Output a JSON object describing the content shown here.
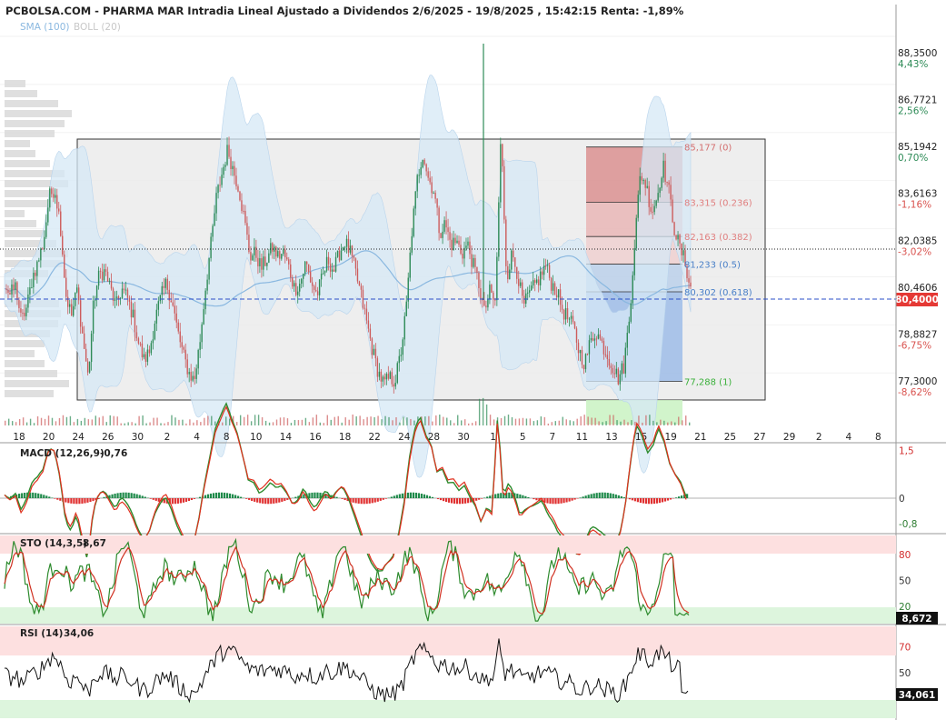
{
  "header": {
    "title": "PCBOLSA.COM - PHARMA MAR Intradia Lineal Ajustado a Dividendos 2/6/2025 - 19/8/2025 , 15:42:15 Renta: -1,89%",
    "legend_sma": "SMA (100)",
    "legend_boll": "BOLL (20)"
  },
  "colors": {
    "up": "#2e8b57",
    "down": "#cd5c5c",
    "band": "#d6e8f5",
    "sma": "#8ab8e0",
    "last_price_bg": "#e53935",
    "macd_line": "#2e8b2e",
    "signal_line": "#e0301e"
  },
  "chart_data": [
    {
      "type": "line",
      "panel": "price",
      "ylim": [
        76.6,
        88.9
      ],
      "x_ticks": [
        "18",
        "20",
        "24",
        "26",
        "30",
        "2",
        "4",
        "8",
        "10",
        "14",
        "16",
        "18",
        "22",
        "24",
        "28",
        "30",
        "1",
        "5",
        "7",
        "11",
        "13",
        "15",
        "19",
        "21",
        "25",
        "27",
        "29",
        "2",
        "4",
        "8"
      ],
      "price_series": [
        80.6,
        80.2,
        80.5,
        79.3,
        79.8,
        80.8,
        81.3,
        82.0,
        83.5,
        83.8,
        82.6,
        80.2,
        79.5,
        80.4,
        78.8,
        77.4,
        80.0,
        80.9,
        81.0,
        80.4,
        79.8,
        80.4,
        80.1,
        79.5,
        78.6,
        78.0,
        78.3,
        79.4,
        80.1,
        80.6,
        80.0,
        79.0,
        78.2,
        77.6,
        77.3,
        78.6,
        80.4,
        81.9,
        83.5,
        84.3,
        85.1,
        84.4,
        83.8,
        82.7,
        81.5,
        81.6,
        81.1,
        81.4,
        81.8,
        81.5,
        81.6,
        81.1,
        80.4,
        80.6,
        81.3,
        80.6,
        80.2,
        80.8,
        81.4,
        81.0,
        81.6,
        82.0,
        81.6,
        80.9,
        80.1,
        79.2,
        78.3,
        77.6,
        77.2,
        77.4,
        77.3,
        78.2,
        79.7,
        82.3,
        84.1,
        85.0,
        84.1,
        83.7,
        82.3,
        82.6,
        81.9,
        82.0,
        81.6,
        81.9,
        81.2,
        80.6,
        79.6,
        80.3,
        79.9,
        85.6,
        80.8,
        81.6,
        80.9,
        79.8,
        80.2,
        80.5,
        80.8,
        81.2,
        80.6,
        80.3,
        79.7,
        79.4,
        79.1,
        78.3,
        77.9,
        78.6,
        79.0,
        78.6,
        78.2,
        77.8,
        77.4,
        77.8,
        79.4,
        82.1,
        84.3,
        83.9,
        83.0,
        83.5,
        84.6,
        83.8,
        82.5,
        81.8,
        81.3,
        80.4
      ],
      "last_price": "80,4000",
      "sma_label": "SMA (100)",
      "boll_label": "BOLL (20)",
      "y_labels": [
        {
          "value": 88.35,
          "price": "88,3500",
          "pct": "4,43%",
          "pct_color": "#2e8b57"
        },
        {
          "value": 86.7721,
          "price": "86,7721",
          "pct": "2,56%",
          "pct_color": "#2e8b57"
        },
        {
          "value": 85.1942,
          "price": "85,1942",
          "pct": "0,70%",
          "pct_color": "#2e8b57"
        },
        {
          "value": 83.6163,
          "price": "83,6163",
          "pct": "-1,16%",
          "pct_color": "#d9534f"
        },
        {
          "value": 82.0385,
          "price": "82,0385",
          "pct": "-3,02%",
          "pct_color": "#d9534f"
        },
        {
          "value": 80.4606,
          "price": "80,4606",
          "pct": "",
          "pct_color": "#d9534f"
        },
        {
          "value": 78.8827,
          "price": "78,8827",
          "pct": "-6,75%",
          "pct_color": "#d9534f"
        },
        {
          "value": 77.3,
          "price": "77,3000",
          "pct": "-8,62%",
          "pct_color": "#d9534f"
        }
      ],
      "fib_levels": [
        {
          "value": 85.177,
          "label": "85,177 (0)",
          "color": "#d47070"
        },
        {
          "value": 83.315,
          "label": "83,315 (0.236)",
          "color": "#e08080"
        },
        {
          "value": 82.163,
          "label": "82,163 (0.382)",
          "color": "#e08080"
        },
        {
          "value": 81.233,
          "label": "81,233 (0.5)",
          "color": "#4a80c8"
        },
        {
          "value": 80.302,
          "label": "80,302 (0.618)",
          "color": "#4a80c8"
        },
        {
          "value": 77.288,
          "label": "77,288 (1)",
          "color": "#3ab03a"
        }
      ]
    },
    {
      "type": "line",
      "panel": "macd",
      "title": "MACD (12,26,9)",
      "value": "-0,76",
      "ylim": [
        -1.0,
        1.7
      ],
      "y_labels": [
        {
          "value": 1.5,
          "text": "1,5",
          "color": "#d32f2f"
        },
        {
          "value": 0,
          "text": "0",
          "color": "#333333"
        },
        {
          "value": -0.8,
          "text": "-0,8",
          "color": "#2e7d32"
        }
      ]
    },
    {
      "type": "line",
      "panel": "sto",
      "title": "STO (14,3,5)",
      "value": "8,67",
      "last_value": "8,672",
      "ylim": [
        0,
        100
      ],
      "zones": {
        "high": 80,
        "low": 20
      },
      "y_labels": [
        {
          "value": 80,
          "text": "80",
          "color": "#d32f2f"
        },
        {
          "value": 50,
          "text": "50",
          "color": "#333333"
        },
        {
          "value": 20,
          "text": "20",
          "color": "#2e7d32"
        }
      ]
    },
    {
      "type": "line",
      "panel": "rsi",
      "title": "RSI (14)",
      "value": "34,06",
      "last_value": "34,061",
      "ylim": [
        15,
        85
      ],
      "zones": {
        "high": 70,
        "low": 30
      },
      "y_labels": [
        {
          "value": 70,
          "text": "70",
          "color": "#d32f2f"
        },
        {
          "value": 50,
          "text": "50",
          "color": "#333333"
        }
      ]
    }
  ]
}
